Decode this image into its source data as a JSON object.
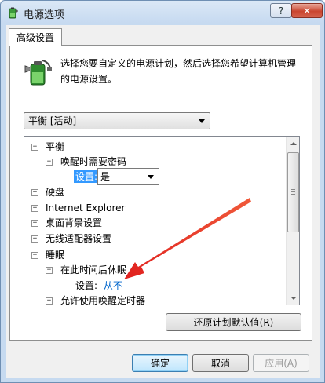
{
  "window": {
    "title": "电源选项",
    "help_glyph": "?",
    "close_glyph": "✕"
  },
  "tab": {
    "label": "高级设置"
  },
  "description": "选择您要自定义的电源计划，然后选择您希望计算机管理的电源设置。",
  "plan_select": {
    "value": "平衡 [活动]"
  },
  "tree": {
    "items": [
      {
        "expander": "⊟",
        "label": "平衡"
      },
      {
        "expander": "⊟",
        "label": "唤醒时需要密码"
      },
      {
        "setting_label": "设置:",
        "setting_value": "是"
      },
      {
        "expander": "⊞",
        "label": "硬盘"
      },
      {
        "expander": "⊞",
        "label": "Internet Explorer"
      },
      {
        "expander": "⊞",
        "label": "桌面背景设置"
      },
      {
        "expander": "⊞",
        "label": "无线适配器设置"
      },
      {
        "expander": "⊟",
        "label": "睡眠"
      },
      {
        "expander": "⊟",
        "label": "在此时间后休眠"
      },
      {
        "setting_label": "设置:",
        "setting_value": "从不"
      },
      {
        "expander": "⊞",
        "label": "允许使用唤醒定时器"
      }
    ]
  },
  "buttons": {
    "restore": "还原计划默认值(R)",
    "ok": "确定",
    "cancel": "取消",
    "apply": "应用(A)"
  },
  "colors": {
    "highlight": "#3399ff",
    "value_blue": "#0066cc",
    "annotation_arrow": "#e8302a"
  },
  "icons": {
    "app": "battery-plug-icon",
    "plan": "battery-plug-icon"
  }
}
